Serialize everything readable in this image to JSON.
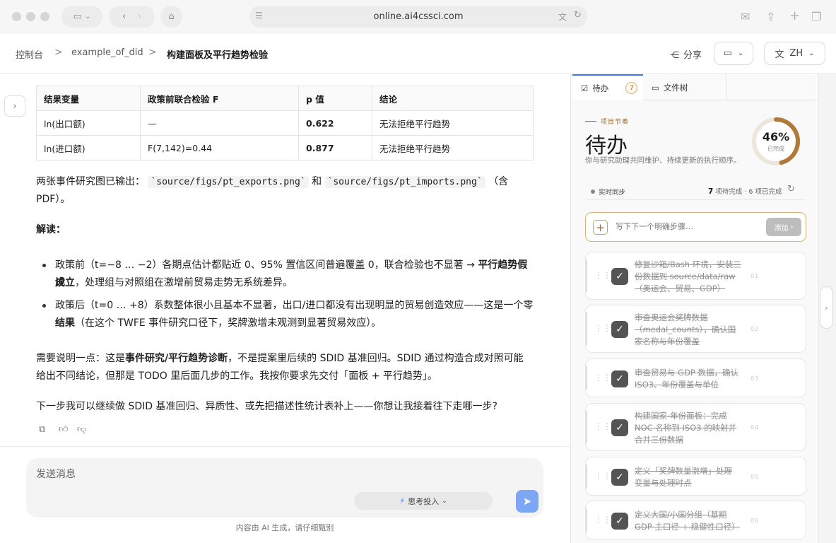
{
  "browser": {
    "url": "online.ai4cssci.com"
  },
  "breadcrumb": {
    "items": [
      "控制台",
      "example_of_did",
      "构建面板及平行趋势检验"
    ],
    "separator": ">"
  },
  "header": {
    "share_label": "分享",
    "language": "ZH"
  },
  "table": {
    "headers": [
      "结果变量",
      "政策前联合检验 F",
      "p 值",
      "结论"
    ],
    "rows": [
      [
        "ln(出口额)",
        "—",
        "0.622",
        "无法拒绝平行趋势"
      ],
      [
        "ln(进口额)",
        "F(7,142)=0.44",
        "0.877",
        "无法拒绝平行趋势"
      ]
    ]
  },
  "message": {
    "figs_prefix": "两张事件研究图已输出：",
    "fig1": "`source/figs/pt_exports.png`",
    "and": "和",
    "fig2": "`source/figs/pt_imports.png`",
    "figs_suffix_1": "（含",
    "figs_suffix_2": "PDF）。",
    "interpret_label": "解读：",
    "b1_a": "政策前（t=−8 … −2）各期点估计都贴近 0、95% 置信区间普遍覆盖 0，联合检验也不显著 →",
    "b1_bold_1": "平行趋势假设",
    "b1_bold_2": "成立",
    "b1_b": "，处理组与对照组在激增前贸易走势无系统差异。",
    "b2_a": "政策后（t=0 … +8）系数整体很小且基本不显著，出口/进口都没有出现明显的贸易创造效应——这是一个零",
    "b2_bold": "结果",
    "b2_b": "（在这个 TWFE 事件研究口径下，奖牌激增未观测到显著贸易效应）。",
    "note_a": "需要说明一点：这是",
    "note_bold": "事件研究/平行趋势诊断",
    "note_b": "，不是提案里后续的 SDID 基准回归。SDID 通过构造合成对照可能",
    "note_line2": "给出不同结论，但那是 TODO 里后面几步的工作。我按你要求先交付「面板 + 平行趋势」。",
    "next_step": "下一步我可以继续做 SDID 基准回归、异质性、或先把描述性统计表补上——你想让我接着往下走哪一步?"
  },
  "composer": {
    "placeholder": "发送消息",
    "think_label": "思考投入",
    "disclaimer": "内容由 AI 生成，请仔细甄别"
  },
  "panel": {
    "tabs": [
      {
        "label": "待办",
        "count": "7"
      },
      {
        "label": "文件树"
      }
    ],
    "eyebrow": "项目节奏",
    "title": "待办",
    "subtitle": "你与研究助理共同维护、持续更新的执行顺序。",
    "progress_text": "46%",
    "progress_fraction": 0.46,
    "progress_label": "已完成",
    "sync_label": "实时同步",
    "stats_count": "7",
    "stats_text": "项待完成 · 6 项已完成",
    "add_placeholder": "写下下一个明确步骤…",
    "add_button": "添加",
    "tasks": [
      {
        "lines": [
          "修复沙箱/Bash 环境，安装三",
          "份数据到 source/data/raw",
          "（奥运会、贸易、GDP）"
        ],
        "num": "01"
      },
      {
        "lines": [
          "审查奥运会奖牌数据",
          "（medal_counts），确认国",
          "家名称与年份覆盖"
        ],
        "num": "02"
      },
      {
        "lines": [
          "审查贸易与 GDP 数据，确认",
          "ISO3、年份覆盖与单位"
        ],
        "num": "03"
      },
      {
        "lines": [
          "构建国家-年份面板：完成",
          "NOC 名称到 ISO3 的映射并",
          "合并三份数据"
        ],
        "num": "04"
      },
      {
        "lines": [
          "定义「奖牌数量激增」处理",
          "变量与处理时点"
        ],
        "num": "05"
      },
      {
        "lines": [
          "定义大国/小国分组（基期",
          "GDP 主口径 + 稳健性口径）"
        ],
        "num": "06"
      }
    ]
  },
  "colors": {
    "accent": "#a06a2c",
    "ring": "#b0783a",
    "send": "#7da6f5",
    "tab_active": "#3f78f0"
  }
}
